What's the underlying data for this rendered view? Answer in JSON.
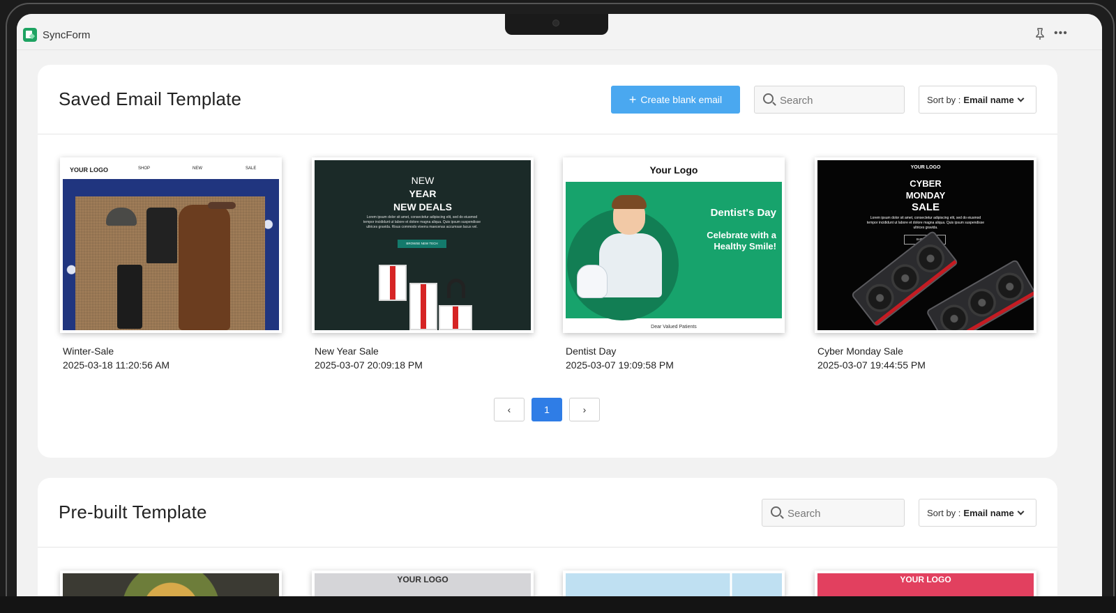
{
  "app": {
    "title": "SyncForm"
  },
  "saved": {
    "title": "Saved Email Template",
    "create_label": "Create blank email",
    "search_placeholder": "Search",
    "sort_prefix": "Sort by :",
    "sort_value": "Email name",
    "templates": [
      {
        "name": "Winter-Sale",
        "date": "2025-03-18 11:20:56 AM",
        "preview": {
          "logo": "YOUR LOGO",
          "nav": [
            "SHOP",
            "NEW",
            "SALE"
          ]
        }
      },
      {
        "name": "New Year Sale",
        "date": "2025-03-07 20:09:18 PM",
        "preview": {
          "line1": "NEW",
          "line2": "YEAR",
          "line3": "NEW DEALS",
          "body": "Lorem ipsum dolor sit amet, consectetur adipiscing elit, sed do eiusmod tempor incididunt ut labore et dolore magna aliqua. Quis ipsum suspendisse ultrices gravida. Risus commodo viverra maecenas accumsan lacus vel.",
          "button": "BROWSE NEW TECH"
        }
      },
      {
        "name": "Dentist Day",
        "date": "2025-03-07 19:09:58 PM",
        "preview": {
          "logo": "Your Logo",
          "headline": "Dentist's Day",
          "tagline": "Celebrate with a Healthy Smile!",
          "footer": "Dear Valued Patients"
        }
      },
      {
        "name": "Cyber Monday Sale",
        "date": "2025-03-07 19:44:55 PM",
        "preview": {
          "logo": "YOUR LOGO",
          "line1": "CYBER",
          "line2": "MONDAY",
          "line3": "SALE",
          "body": "Lorem ipsum dolor sit amet, consectetur adipiscing elit, sed do eiusmod tempor incididunt ut labore et dolore magna aliqua. Quis ipsum suspendisse ultrices gravida.",
          "button": "SHOP NOW"
        }
      }
    ],
    "pagination": {
      "prev": "‹",
      "current": "1",
      "next": "›"
    }
  },
  "prebuilt": {
    "title": "Pre-built Template",
    "search_placeholder": "Search",
    "sort_prefix": "Sort by :",
    "sort_value": "Email name",
    "peeks": [
      "",
      "YOUR LOGO",
      "",
      "YOUR LOGO"
    ]
  },
  "colors": {
    "primary": "#4aa8f0",
    "page_active": "#2f7de6",
    "brand": "#1ea362"
  }
}
